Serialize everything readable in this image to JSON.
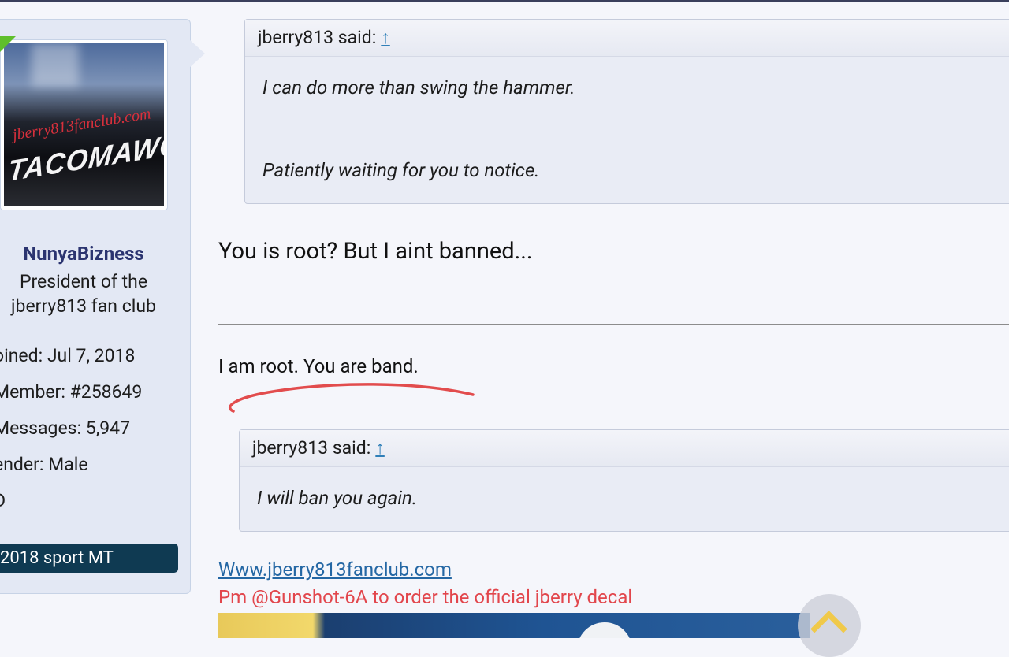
{
  "user": {
    "username": "NunyaBizness",
    "title": "President of the jberry813 fan club",
    "title_line1": "President of the",
    "title_line2": "jberry813 fan club",
    "avatar_text_red": "jberry813fanclub.com",
    "avatar_text_white": "TACOMAWO",
    "stats": {
      "joined": "oined:  Jul 7, 2018",
      "member": "Member:  #258649",
      "messages": "Messages:  5,947",
      "gender": "ender:  Male",
      "extra": "D"
    },
    "vehicle": "2018 sport MT"
  },
  "quote1": {
    "author": "jberry813 said:",
    "up_icon": "↑",
    "line1": "I can do more than swing the hammer.",
    "line2": "Patiently waiting for you to notice."
  },
  "post": {
    "reply1": "You is root? But I aint banned...",
    "reply2": "I am root. You are band."
  },
  "quote2": {
    "author": "jberry813 said:",
    "up_icon": "↑",
    "line1": "I will ban you again."
  },
  "signature": {
    "link": "Www.jberry813fanclub.com",
    "order_text": "Pm @Gunshot-6A to order the official jberry decal"
  },
  "colors": {
    "username": "#2b3470",
    "link": "#2467a4",
    "order": "#e2464c",
    "badge": "#0f3a52",
    "annotation": "#e03a3a"
  },
  "icons": {
    "scroll_top": "chevron-up-icon",
    "quote_jump": "arrow-up-icon"
  }
}
